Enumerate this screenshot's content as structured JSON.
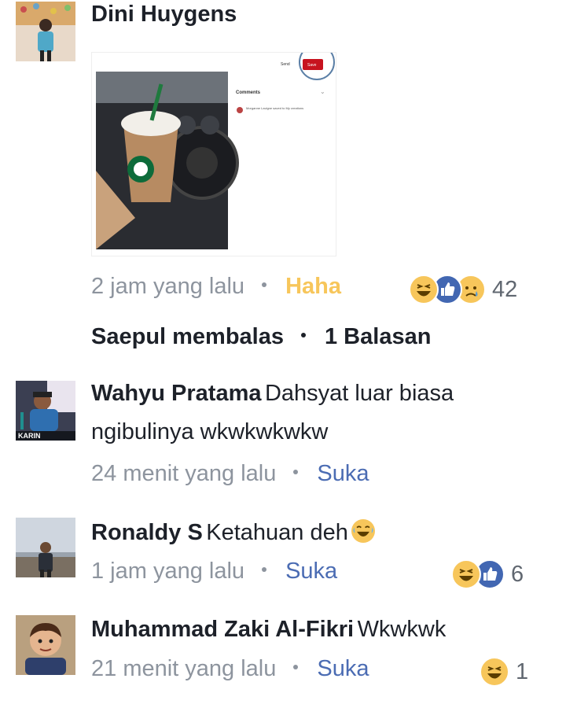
{
  "comments": [
    {
      "author": "Dini Huygens",
      "time": "2 jam yang lalu",
      "action": "Haha",
      "reaction_icons": [
        "haha-icon",
        "like-icon",
        "sad-icon"
      ],
      "reaction_count": "42",
      "attachment": {
        "screenshot_share_label": "Send",
        "screenshot_save_label": "Save",
        "screenshot_comments_label": "Comments",
        "screenshot_activity_text": "Morganne Lavigne saved to My creations"
      }
    },
    {
      "author": "Wahyu Pratama",
      "text": "Dahsyat luar biasa ngibulinya wkwkwkwkw",
      "time": "24 menit yang lalu",
      "action": "Suka",
      "avatar_caption": "KARIN"
    },
    {
      "author": "Ronaldy S",
      "text": "Ketahuan deh",
      "time": "1 jam yang lalu",
      "action": "Suka",
      "reaction_icons": [
        "haha-icon",
        "like-icon"
      ],
      "reaction_count": "6"
    },
    {
      "author": "Muhammad Zaki Al-Fikri",
      "text": "Wkwkwk",
      "time": "21 menit yang lalu",
      "action": "Suka",
      "reaction_icons": [
        "haha-icon"
      ],
      "reaction_count": "1"
    }
  ],
  "replies": {
    "replier": "Saepul membalas",
    "count_label": "1 Balasan"
  },
  "colors": {
    "name": "#1d2129",
    "meta": "#8d949e",
    "suka": "#4b6cb3",
    "haha": "#f7c65b",
    "like_blue": "#4267b2"
  }
}
